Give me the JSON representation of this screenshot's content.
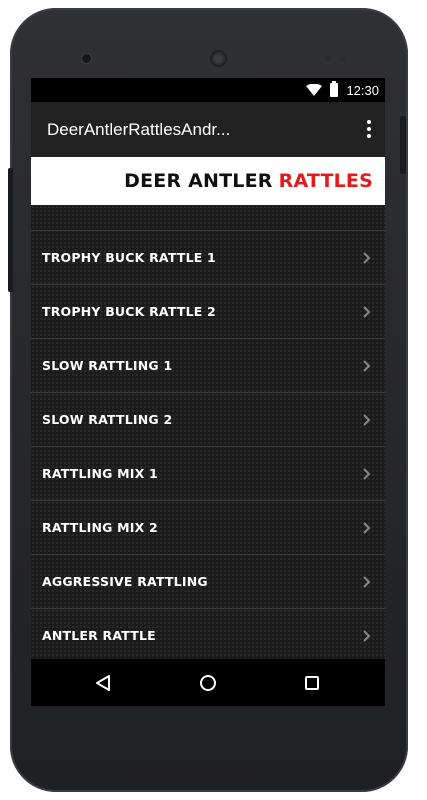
{
  "status_bar": {
    "time": "12:30"
  },
  "app_bar": {
    "title": "DeerAntlerRattlesAndr..."
  },
  "banner": {
    "text_black": "DEER ANTLER",
    "text_red": "RATTLES",
    "accent_color": "#e31b1b"
  },
  "list": {
    "items": [
      {
        "label": "TROPHY BUCK RATTLE 1"
      },
      {
        "label": "TROPHY BUCK RATTLE 2"
      },
      {
        "label": "SLOW RATTLING 1"
      },
      {
        "label": "SLOW RATTLING 2"
      },
      {
        "label": "RATTLING MIX 1"
      },
      {
        "label": "RATTLING MIX 2"
      },
      {
        "label": "AGGRESSIVE RATTLING"
      },
      {
        "label": "ANTLER RATTLE"
      }
    ]
  },
  "nav_bar": {
    "icons": [
      "back-icon",
      "home-icon",
      "recents-icon"
    ]
  }
}
